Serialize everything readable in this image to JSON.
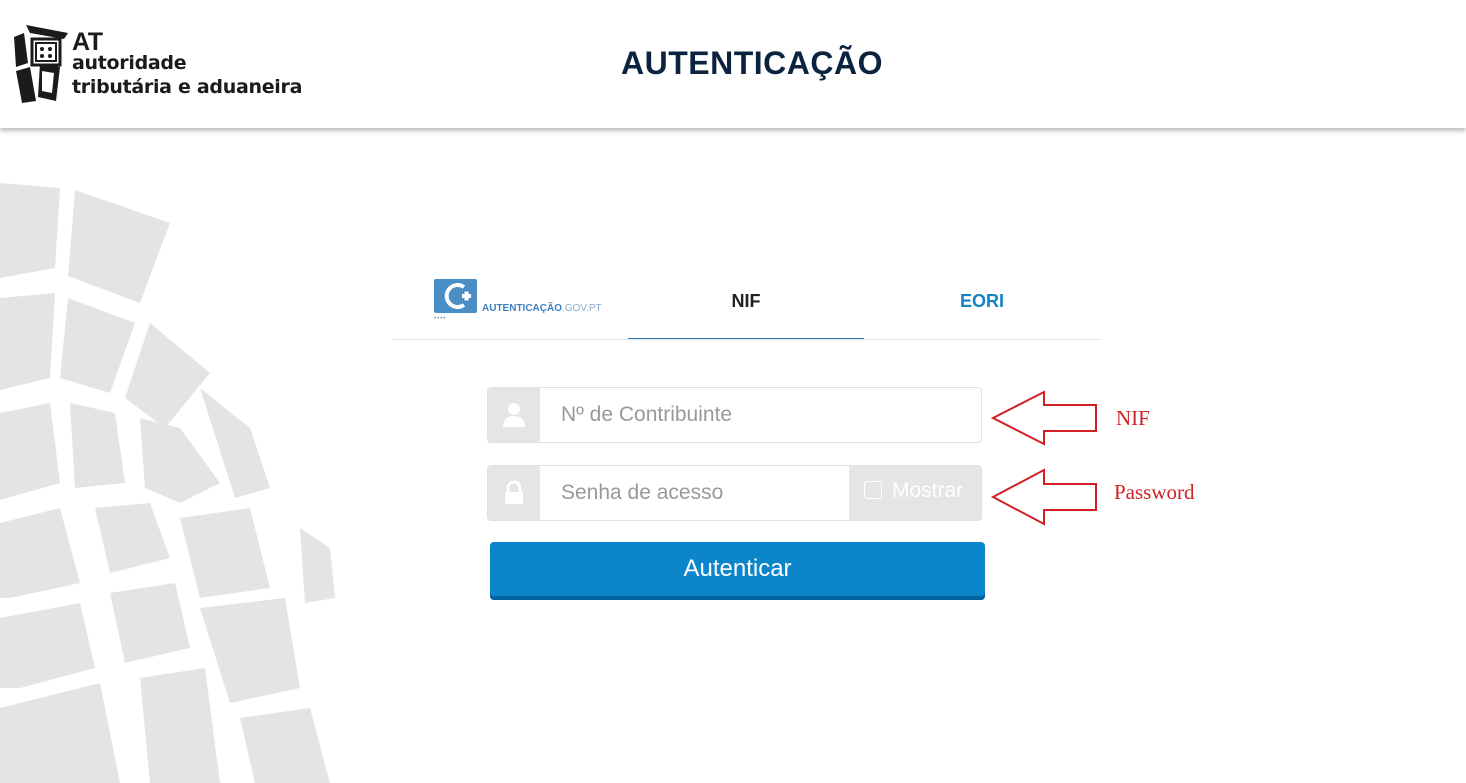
{
  "header": {
    "logo": {
      "abbr": "AT",
      "line1": "autoridade",
      "line2": "tributária e aduaneira"
    },
    "title": "AUTENTICAÇÃO"
  },
  "tabs": {
    "gov": {
      "logo_text_bold": "AUTENTICAÇÃO",
      "logo_text_light": ".GOV.PT"
    },
    "nif_label": "NIF",
    "eori_label": "EORI",
    "active": "NIF"
  },
  "form": {
    "nif_placeholder": "Nº de Contribuinte",
    "password_placeholder": "Senha de acesso",
    "show_label": "Mostrar",
    "submit_label": "Autenticar"
  },
  "annotations": {
    "nif": "NIF",
    "password": "Password"
  },
  "colors": {
    "header_title": "#0c2340",
    "tab_underline": "#2f7ab8",
    "eori_tab": "#1582c7",
    "button": "#0b86cb",
    "annotation": "#d21f26",
    "addon": "#e5e5e5"
  },
  "icons": [
    "at-logo-icon",
    "user-icon",
    "lock-icon",
    "checkbox-icon",
    "arrow-left-icon"
  ]
}
